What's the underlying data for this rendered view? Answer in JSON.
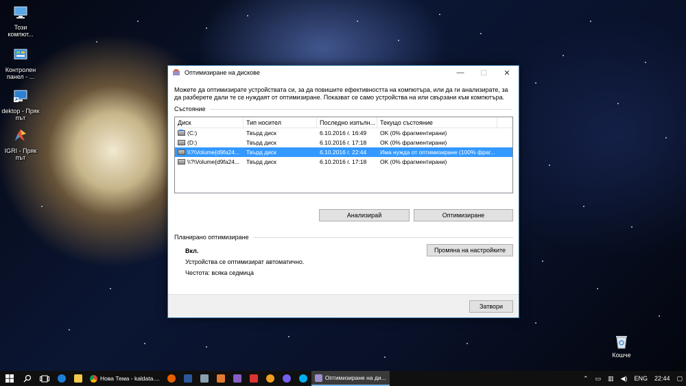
{
  "desktop": {
    "icons": [
      {
        "label": "Този компют...",
        "icon": "computer-icon"
      },
      {
        "label": "Контролен панел - ...",
        "icon": "control-panel-icon"
      },
      {
        "label": "dektop - Пряк път",
        "icon": "shortcut-icon"
      },
      {
        "label": "IGRI - Пряк път",
        "icon": "folder-shortcut-icon"
      }
    ],
    "recycle_bin": "Кошче"
  },
  "window": {
    "title": "Оптимизиране на дискове",
    "description": "Можете да оптимизирате устройствата си, за да повишите ефективността на компютъра, или да ги анализирате, за да разберете дали те се нуждаят от оптимизиране. Показват се само устройства на или свързани към компютъра.",
    "status_section": "Състояние",
    "columns": [
      "Диск",
      "Тип носител",
      "Последно изпълн...",
      "Текущо състояние"
    ],
    "drives": [
      {
        "disk": "(C:)",
        "media": "Твърд диск",
        "last_run": "6.10.2016 г. 16:49",
        "status": "OK (0% фрагментирани)"
      },
      {
        "disk": "(D:)",
        "media": "Твърд диск",
        "last_run": "6.10.2016 г. 17:18",
        "status": "OK (0% фрагментирани)"
      },
      {
        "disk": "\\\\?\\Volume{d9fa24...",
        "media": "Твърд диск",
        "last_run": "6.10.2016 г. 22:44",
        "status": "Има нужда от оптимизиране (100% фраг..."
      },
      {
        "disk": "\\\\?\\Volume{d9fa24...",
        "media": "Твърд диск",
        "last_run": "6.10.2016 г. 17:18",
        "status": "OK (0% фрагментирани)"
      }
    ],
    "analyze_label": "Анализирай",
    "optimize_label": "Оптимизиране",
    "scheduled_section": "Планирано оптимизиране",
    "schedule_state": "Вкл.",
    "schedule_desc": "Устройства се оптимизират автоматично.",
    "schedule_freq": "Честота: всяка седмица",
    "change_settings_label": "Промяна на настройките",
    "close_label": "Затвори"
  },
  "taskbar": {
    "tasks": [
      {
        "label": "Нова Тема - kaldata....",
        "color": "#4a8af4"
      },
      {
        "label": "Оптимизиране на ди...",
        "color": "#7a6fb0"
      }
    ],
    "lang": "ENG",
    "time": "22:44"
  },
  "colors": {
    "accent": "#3399ff",
    "window_border": "#3c7fb1",
    "taskbar": "#101010"
  }
}
